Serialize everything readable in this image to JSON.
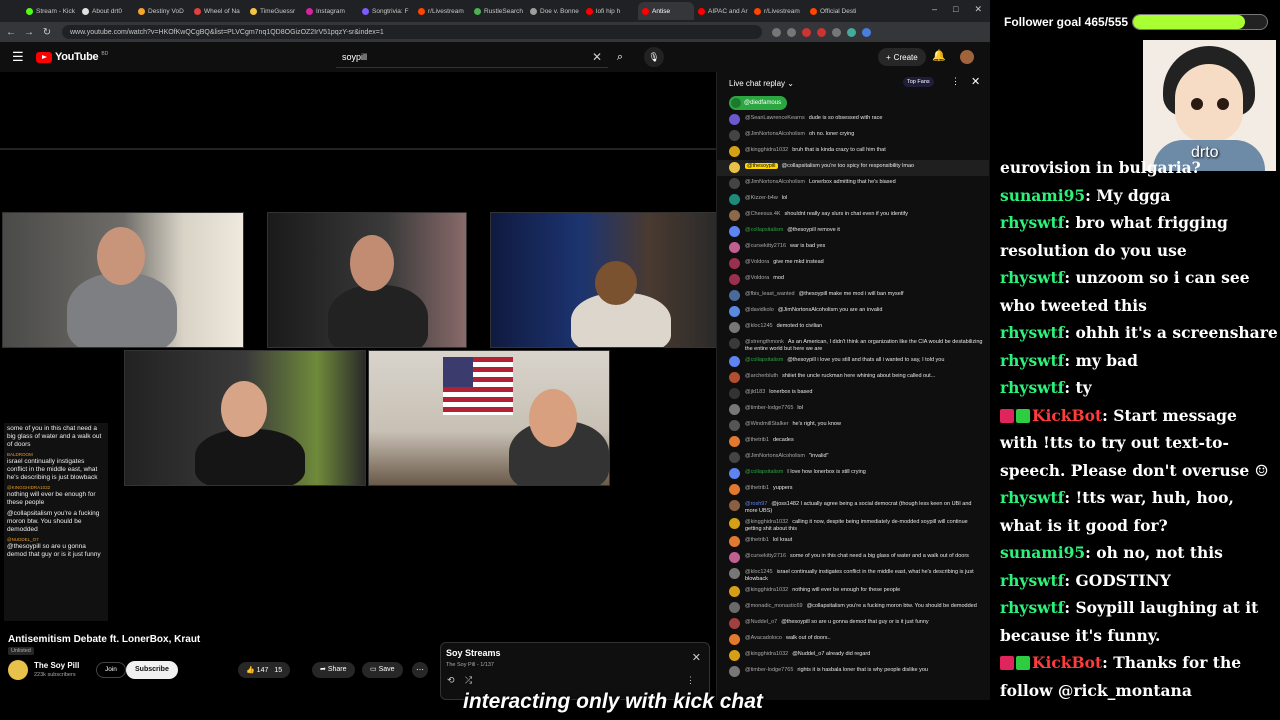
{
  "browser": {
    "tabs": [
      {
        "label": "Stream - Kick",
        "color": "#53fc18"
      },
      {
        "label": "About drt0",
        "color": "#e0e0e0"
      },
      {
        "label": "Destiny VoD",
        "color": "#f4a52a"
      },
      {
        "label": "Wheel of Na",
        "color": "#e04040"
      },
      {
        "label": "TimeGuessr",
        "color": "#f4c542"
      },
      {
        "label": "Instagram",
        "color": "#d6249f"
      },
      {
        "label": "Songtrivia: F",
        "color": "#7b5cff"
      },
      {
        "label": "r/Livestream",
        "color": "#ff4500"
      },
      {
        "label": "RustleSearch",
        "color": "#4caf50"
      },
      {
        "label": "Doe v. Bonne",
        "color": "#9e9e9e"
      },
      {
        "label": "lofi hip h",
        "color": "#ff0000"
      },
      {
        "label": "Antise",
        "color": "#ff0000"
      },
      {
        "label": "AIPAC and Ar",
        "color": "#ff0000"
      },
      {
        "label": "r/Livestream",
        "color": "#ff4500"
      },
      {
        "label": "Official Desti",
        "color": "#ff4500"
      }
    ],
    "url": "www.youtube.com/watch?v=HKOfKwQCgBQ&list=PLVCgm7nq1QD8OGizOZ2IrV51pqzY-sr&index=1"
  },
  "youtube": {
    "logo": "YouTube",
    "logo_sup": "BD",
    "search_value": "soypill",
    "create_label": "Create",
    "video_title": "Antisemitism Debate ft. LonerBox, Kraut",
    "unlisted": "Unlisted",
    "channel_name": "The Soy Pill",
    "channel_subs": "223k subscribers",
    "join_label": "Join",
    "subscribe_label": "Subscribe",
    "likes": "147",
    "dislikes": "15",
    "share_label": "Share",
    "save_label": "Save",
    "playlist_title": "Soy Streams",
    "playlist_sub": "The Soy Pill - 1/137",
    "caption": "interacting only with kick chat"
  },
  "overlay_chat": [
    {
      "name": "",
      "text": "some of you in this chat need a big glass of water and a walk out of doors"
    },
    {
      "name": "BALDROOM",
      "text": "israel continually instigates conflict in the middle east, what he's describing is just blowback"
    },
    {
      "name": "@KINGGHIDRA1032",
      "text": "nothing will ever be enough for these people"
    },
    {
      "name": "",
      "text": "@collapsitalism you're a fucking moron btw. You should be demodded"
    },
    {
      "name": "@NUDDEL_O7",
      "text": "@thesoypill so are u gonna demod that guy or is it just funny"
    }
  ],
  "live_chat": {
    "header": "Live chat replay",
    "top_fans": "Top Fans",
    "pinned_user": "@diedfamous",
    "messages": [
      {
        "author": "@SeanLawrenceKearns",
        "text": "dude is so obsessed with race",
        "color": "#6a5acd",
        "type": ""
      },
      {
        "author": "@JimNortonsAlcoholism",
        "text": "oh no. loner crying",
        "color": "#444",
        "type": ""
      },
      {
        "author": "@kingghidra1032",
        "text": "bruh that is kinda crazy to call him that",
        "color": "#d4a017",
        "type": ""
      },
      {
        "author": "@thesoypill",
        "text": "@collapsitalism you're too spicy for responsibility lmao",
        "color": "#e8c14a",
        "type": "owner"
      },
      {
        "author": "@JimNortonsAlcoholism",
        "text": "Lonerbox admitting that he's biased",
        "color": "#444",
        "type": ""
      },
      {
        "author": "@Kizzer-b4w",
        "text": "lol",
        "color": "#1e8a7a",
        "type": ""
      },
      {
        "author": "@Cheesus.4K",
        "text": "shouldnt really say slurs in chat even if you identify",
        "color": "#8a6a4a",
        "type": ""
      },
      {
        "author": "@collapsitalism",
        "text": "@thesoypill remove it",
        "color": "#5e84f1",
        "type": "mod"
      },
      {
        "author": "@cursekitty2716",
        "text": "war is bad yes",
        "color": "#c06090",
        "type": ""
      },
      {
        "author": "@Voldora",
        "text": "give me mkd instead",
        "color": "#9a3050",
        "type": ""
      },
      {
        "author": "@Voldora",
        "text": "mod",
        "color": "#9a3050",
        "type": ""
      },
      {
        "author": "@fbis_least_wanted",
        "text": "@thesoypill make me mod i will ban myself",
        "color": "#4a6a9a",
        "type": ""
      },
      {
        "author": "@davidkolo",
        "text": "@JimNortonsAlcoholism you are an invalid",
        "color": "#5a8adf",
        "type": ""
      },
      {
        "author": "@kloc1245",
        "text": "demoted to civilian",
        "color": "#777",
        "type": ""
      },
      {
        "author": "@strengthmonk",
        "text": "As an American, I didn't think an organization like the CIA would be destabilizing the entire world but here we are",
        "color": "#3a3a3a",
        "type": ""
      },
      {
        "author": "@collapsitalism",
        "text": "@thesoypill i love you still and thats all i wanted to say, I told you",
        "color": "#5e84f1",
        "type": "mod"
      },
      {
        "author": "@archerbluth",
        "text": "shiiiet the uncle ruckman here whining about being called out...",
        "color": "#b05030",
        "type": ""
      },
      {
        "author": "@jld183",
        "text": "lonerbox is based",
        "color": "#333",
        "type": ""
      },
      {
        "author": "@timber-lodge7765",
        "text": "lol",
        "color": "#777",
        "type": ""
      },
      {
        "author": "@WindmillStalker",
        "text": "he's right, you know",
        "color": "#555",
        "type": ""
      },
      {
        "author": "@thetrib1",
        "text": "decades",
        "color": "#e07a30",
        "type": ""
      },
      {
        "author": "@JimNortonsAlcoholism",
        "text": "\"invalid\"",
        "color": "#444",
        "type": ""
      },
      {
        "author": "@collapsitalism",
        "text": "I love how lonerbox is still crying",
        "color": "#5e84f1",
        "type": "mod"
      },
      {
        "author": "@thetrib1",
        "text": "yuppers",
        "color": "#e07a30",
        "type": ""
      },
      {
        "author": "@rosh97",
        "text": "@joss1482 I actually agree being a social democrat (though less keen on UBI and more UBS)",
        "color": "#8a6040",
        "type": "mem"
      },
      {
        "author": "@kingghidra1032",
        "text": "calling it now, despite being immediately de-modded soypill will continue getting shit about this",
        "color": "#d4a017",
        "type": ""
      },
      {
        "author": "@thetrib1",
        "text": "lol kraut",
        "color": "#e07a30",
        "type": ""
      },
      {
        "author": "@cursekitty2716",
        "text": "some of you in this chat need a big glass of water and a walk out of doors",
        "color": "#c06090",
        "type": ""
      },
      {
        "author": "@kloc1245",
        "text": "israel continually instigates conflict in the middle east, what he's describing is just blowback",
        "color": "#777",
        "type": ""
      },
      {
        "author": "@kingghidra1032",
        "text": "nothing will ever be enough for these people",
        "color": "#d4a017",
        "type": ""
      },
      {
        "author": "@monadic_monastic69",
        "text": "@collapsitalism you're a fucking moron btw. You should be demodded",
        "color": "#6a6a6a",
        "type": ""
      },
      {
        "author": "@Nuddel_o7",
        "text": "@thesoypill so are u gonna demod that guy or is it just funny",
        "color": "#a04040",
        "type": ""
      },
      {
        "author": "@Avacadoloco",
        "text": "walk out of doors..",
        "color": "#e07a30",
        "type": ""
      },
      {
        "author": "@kingghidra1032",
        "text": "@Nuddel_o7 already did regard",
        "color": "#d4a017",
        "type": ""
      },
      {
        "author": "@timber-lodge7765",
        "text": "rights it is hasbala loner that is why people dislike you",
        "color": "#777",
        "type": ""
      }
    ]
  },
  "stream_overlay": {
    "goal_label": "Follower goal 465/555",
    "goal_progress": 0.8378,
    "goal_color": "#aaff33",
    "webcam_name": "drto",
    "messages": [
      {
        "name": "",
        "text": "eurovision in bulgaria?",
        "bot": false
      },
      {
        "name": "sunami95",
        "text": "My dgga",
        "bot": false
      },
      {
        "name": "rhyswtf",
        "text": "bro what frigging resolution do you use",
        "bot": false
      },
      {
        "name": "rhyswtf",
        "text": "unzoom so i can see who tweeted this",
        "bot": false
      },
      {
        "name": "rhyswtf",
        "text": "ohhh it's a screenshare",
        "bot": false
      },
      {
        "name": "rhyswtf",
        "text": "my bad",
        "bot": false
      },
      {
        "name": "rhyswtf",
        "text": "ty",
        "bot": false
      },
      {
        "name": "KickBot",
        "text": "Start message with !tts to try out text-to-speech. Please don't overuse ☺",
        "bot": true
      },
      {
        "name": "rhyswtf",
        "text": "!tts war, huh, hoo, what is it good for?",
        "bot": false
      },
      {
        "name": "sunami95",
        "text": "oh no, not this",
        "bot": false
      },
      {
        "name": "rhyswtf",
        "text": "GODSTINY",
        "bot": false
      },
      {
        "name": "rhyswtf",
        "text": "Soypill laughing at it because it's funny.",
        "bot": false
      },
      {
        "name": "KickBot",
        "text": "Thanks for the follow @rick_montana",
        "bot": true
      }
    ]
  }
}
